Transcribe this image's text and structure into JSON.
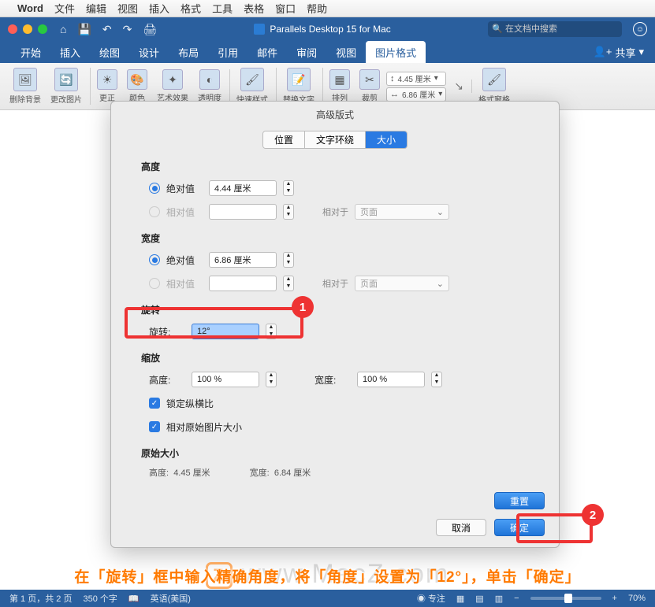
{
  "menubar": {
    "app": "Word",
    "items": [
      "文件",
      "编辑",
      "视图",
      "插入",
      "格式",
      "工具",
      "表格",
      "窗口",
      "帮助"
    ]
  },
  "titlebar": {
    "doc_title": "Parallels Desktop 15 for Mac",
    "search_placeholder": "在文档中搜索"
  },
  "ribbon_tabs": {
    "items": [
      "开始",
      "插入",
      "绘图",
      "设计",
      "布局",
      "引用",
      "邮件",
      "审阅",
      "视图",
      "图片格式"
    ],
    "active": "图片格式",
    "share_label": "共享"
  },
  "ribbon": {
    "remove_bg": "删除背景",
    "corrections": "更正",
    "change_pic": "更改图片",
    "color": "颜色",
    "artistic": "艺术效果",
    "transparency": "透明度",
    "quick_style": "快速样式",
    "replace": "替换文字",
    "arrange": "排列",
    "crop": "裁剪",
    "height_val": "4.45 厘米",
    "width_val": "6.86 厘米",
    "format_pane": "格式窗格"
  },
  "dialog": {
    "title": "高级版式",
    "tabs": {
      "position": "位置",
      "text_wrap": "文字环绕",
      "size": "大小"
    },
    "sections": {
      "height": {
        "title": "高度",
        "absolute_label": "绝对值",
        "absolute_value": "4.44 厘米",
        "relative_label": "相对值",
        "relative_to_label": "相对于",
        "relative_to_value": "页面"
      },
      "width": {
        "title": "宽度",
        "absolute_label": "绝对值",
        "absolute_value": "6.86 厘米",
        "relative_label": "相对值",
        "relative_to_label": "相对于",
        "relative_to_value": "页面"
      },
      "rotation": {
        "title": "旋转",
        "label": "旋转:",
        "value": "12°"
      },
      "scale": {
        "title": "缩放",
        "height_label": "高度:",
        "height_value": "100 %",
        "width_label": "宽度:",
        "width_value": "100 %",
        "lock_aspect": "锁定纵横比",
        "relative_orig": "相对原始图片大小"
      },
      "original": {
        "title": "原始大小",
        "height_label": "高度:",
        "height_value": "4.45 厘米",
        "width_label": "宽度:",
        "width_value": "6.84 厘米"
      }
    },
    "buttons": {
      "reset": "重置",
      "cancel": "取消",
      "ok": "确定"
    }
  },
  "annotations": {
    "badge1": "1",
    "badge2": "2",
    "caption": "在「旋转」框中输入精确角度，将「角度」设置为「12°」，单击「确定」",
    "watermark": "www.MacZ.com"
  },
  "statusbar": {
    "page": "第 1 页，共 2 页",
    "words": "350 个字",
    "lang": "英语(美国)",
    "focus": "专注",
    "zoom": "70%"
  }
}
